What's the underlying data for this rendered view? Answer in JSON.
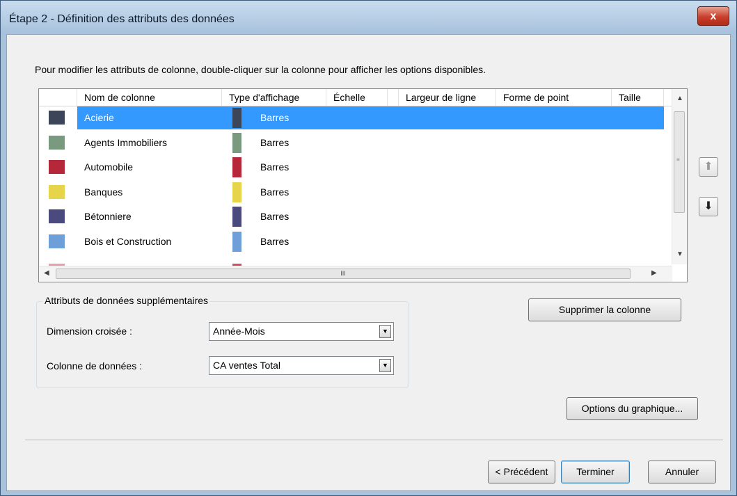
{
  "window": {
    "title": "Étape 2 - Définition des attributs des données",
    "close_label": "x"
  },
  "instruction": "Pour modifier les attributs de colonne, double-cliquer sur la colonne pour afficher les options disponibles.",
  "columns": [
    "Nom de colonne",
    "Type d'affichage",
    "Échelle",
    "Largeur de ligne",
    "Forme de point",
    "Taille"
  ],
  "rows": [
    {
      "name": "Acierie",
      "type": "Barres",
      "color": "#3d4658",
      "selected": true
    },
    {
      "name": "Agents Immobiliers",
      "type": "Barres",
      "color": "#7a9a80",
      "selected": false
    },
    {
      "name": "Automobile",
      "type": "Barres",
      "color": "#b6273a",
      "selected": false
    },
    {
      "name": "Banques",
      "type": "Barres",
      "color": "#e6d44a",
      "selected": false
    },
    {
      "name": "Bétonniere",
      "type": "Barres",
      "color": "#4a4a7e",
      "selected": false
    },
    {
      "name": "Bois et Construction",
      "type": "Barres",
      "color": "#6e9fd8",
      "selected": false
    }
  ],
  "hscroll_grip": "III",
  "buttons": {
    "move_up": "up-arrow-icon",
    "move_down": "down-arrow-icon",
    "delete_column": "Supprimer la colonne",
    "chart_options": "Options du graphique...",
    "previous": "< Précédent",
    "finish": "Terminer",
    "cancel": "Annuler"
  },
  "extra_attributes": {
    "legend": "Attributs de données supplémentaires",
    "cross_dimension_label": "Dimension croisée :",
    "cross_dimension_value": "Année-Mois",
    "data_column_label": "Colonne de données :",
    "data_column_value": "CA ventes Total"
  }
}
